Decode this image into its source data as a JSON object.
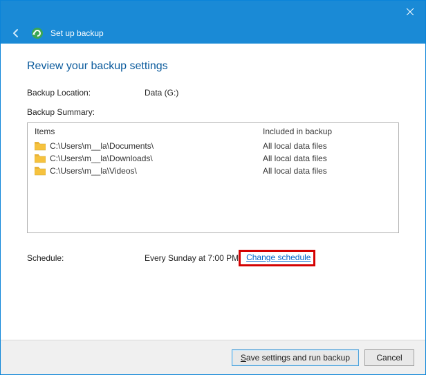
{
  "window": {
    "title": "Set up backup",
    "close_tooltip": "Close"
  },
  "page": {
    "heading": "Review your backup settings",
    "location_label": "Backup Location:",
    "location_value": "Data (G:)",
    "summary_label": "Backup Summary:"
  },
  "table": {
    "col_items": "Items",
    "col_included": "Included in backup",
    "rows": [
      {
        "path": "C:\\Users\\m__la\\Documents\\",
        "included": "All local data files"
      },
      {
        "path": "C:\\Users\\m__la\\Downloads\\",
        "included": "All local data files"
      },
      {
        "path": "C:\\Users\\m__la\\Videos\\",
        "included": "All local data files"
      }
    ]
  },
  "schedule": {
    "label": "Schedule:",
    "value": "Every Sunday at 7:00 PM",
    "change_link": "Change schedule"
  },
  "buttons": {
    "save_mnemonic": "S",
    "save_rest": "ave settings and run backup",
    "cancel": "Cancel"
  }
}
